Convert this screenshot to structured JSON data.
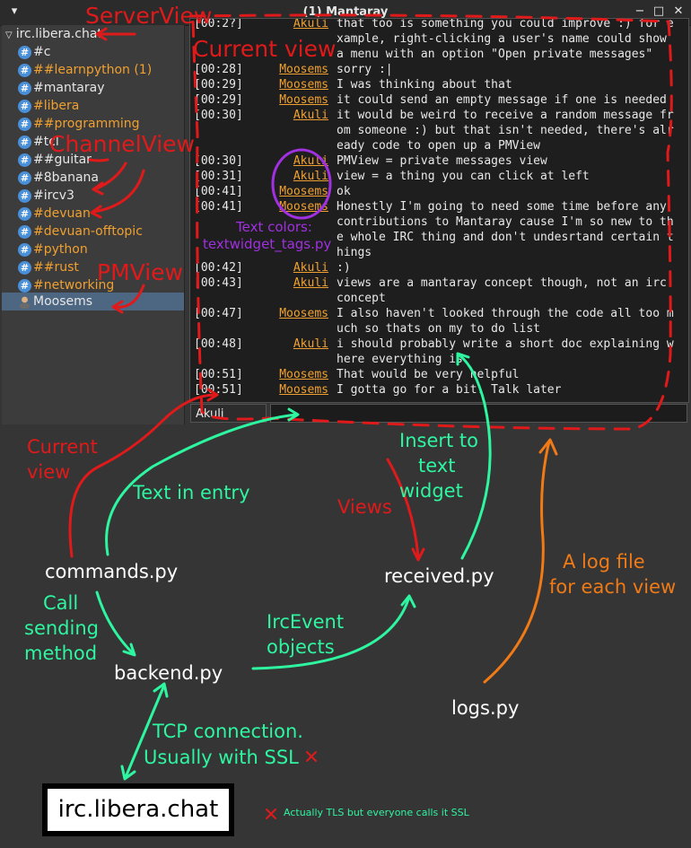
{
  "window": {
    "title": "(1) Mantaray",
    "minimize_glyph": "−",
    "maximize_glyph": "□",
    "close_glyph": "✕",
    "menu_glyph": "▾"
  },
  "sidebar": {
    "server": "irc.libera.chat",
    "channels": [
      {
        "label": "#c",
        "active": false
      },
      {
        "label": "##learnpython (1)",
        "active": true
      },
      {
        "label": "#mantaray",
        "active": false
      },
      {
        "label": "#libera",
        "active": true
      },
      {
        "label": "##programming",
        "active": true
      },
      {
        "label": "#tcl",
        "active": false
      },
      {
        "label": "##guitar",
        "active": false
      },
      {
        "label": "#8banana",
        "active": false
      },
      {
        "label": "#ircv3",
        "active": false
      },
      {
        "label": "#devuan",
        "active": true
      },
      {
        "label": "#devuan-offtopic",
        "active": true
      },
      {
        "label": "#python",
        "active": true
      },
      {
        "label": "##rust",
        "active": true
      },
      {
        "label": "#networking",
        "active": true
      }
    ],
    "pm": "Moosems"
  },
  "chat": {
    "lines": [
      {
        "ts": "[00:2?]",
        "nick": "Akuli",
        "msg": "that too is something you could improve :) for e"
      },
      {
        "ts": "",
        "nick": "",
        "msg": "xample, right-clicking a user's name could show"
      },
      {
        "ts": "",
        "nick": "",
        "msg": "a menu with an option \"Open private messages\""
      },
      {
        "ts": "[00:28]",
        "nick": "Moosems",
        "msg": "sorry :|"
      },
      {
        "ts": "[00:29]",
        "nick": "Moosems",
        "msg": "I was thinking about that"
      },
      {
        "ts": "[00:29]",
        "nick": "Moosems",
        "msg": "it could send an empty message if one is needed"
      },
      {
        "ts": "[00:30]",
        "nick": "Akuli",
        "msg": "it would be weird to receive a random message fr"
      },
      {
        "ts": "",
        "nick": "",
        "msg": "om someone :) but that isn't needed, there's alr"
      },
      {
        "ts": "",
        "nick": "",
        "msg": "eady code to open up a PMView"
      },
      {
        "ts": "[00:30]",
        "nick": "Akuli",
        "msg": "PMView = private messages view"
      },
      {
        "ts": "[00:31]",
        "nick": "Akuli",
        "msg": "view = a thing you can click at left"
      },
      {
        "ts": "[00:41]",
        "nick": "Moosems",
        "msg": "ok"
      },
      {
        "ts": "[00:41]",
        "nick": "Moosems",
        "msg": "Honestly I'm going to need some time before any"
      },
      {
        "ts": "",
        "nick": "",
        "msg": "contributions to Mantaray cause I'm so new to th"
      },
      {
        "ts": "",
        "nick": "",
        "msg": "e whole IRC thing and don't undesrtand certain t"
      },
      {
        "ts": "",
        "nick": "",
        "msg": "hings"
      },
      {
        "ts": "[00:42]",
        "nick": "Akuli",
        "msg": ":)"
      },
      {
        "ts": "[00:43]",
        "nick": "Akuli",
        "msg": "views are a mantaray concept though, not an irc"
      },
      {
        "ts": "",
        "nick": "",
        "msg": "concept"
      },
      {
        "ts": "[00:47]",
        "nick": "Moosems",
        "msg": "I also haven't looked through the code all too m"
      },
      {
        "ts": "",
        "nick": "",
        "msg": "uch so thats on my to do list"
      },
      {
        "ts": "[00:48]",
        "nick": "Akuli",
        "msg": "i should probably write a short doc explaining w"
      },
      {
        "ts": "",
        "nick": "",
        "msg": "here everything is"
      },
      {
        "ts": "[00:51]",
        "nick": "Moosems",
        "msg": "That would be very helpful"
      },
      {
        "ts": "[00:51]",
        "nick": "Moosems",
        "msg": "I gotta go for a bit. Talk later"
      }
    ]
  },
  "entry": {
    "nick": "Akuli",
    "value": ""
  },
  "annotations": {
    "server_view": "ServerView",
    "current_view_top": "Current view",
    "channel_view": "ChannelView",
    "pm_view": "PMView",
    "text_colors_1": "Text colors:",
    "text_colors_2": "textwidget_tags.py",
    "current_view_1": "Current",
    "current_view_2": "view",
    "text_in_entry": "Text in entry",
    "insert_1": "Insert to",
    "insert_2": "text",
    "insert_3": "widget",
    "views": "Views",
    "log_1": "A log file",
    "log_2": "for each view",
    "commands": "commands.py",
    "received": "received.py",
    "call_1": "Call",
    "call_2": "sending",
    "call_3": "method",
    "irc_1": "IrcEvent",
    "irc_2": "objects",
    "backend": "backend.py",
    "logs": "logs.py",
    "tcp_1": "TCP connection.",
    "tcp_2": "Usually with SSL",
    "server_box": "irc.libera.chat",
    "footnote": "Actually TLS but everyone calls it SSL",
    "colors": {
      "red": "#e01a1a",
      "green": "#2ef5a0",
      "orange": "#f07a16",
      "purple": "#a030e0",
      "nick": "#f0a030"
    }
  }
}
